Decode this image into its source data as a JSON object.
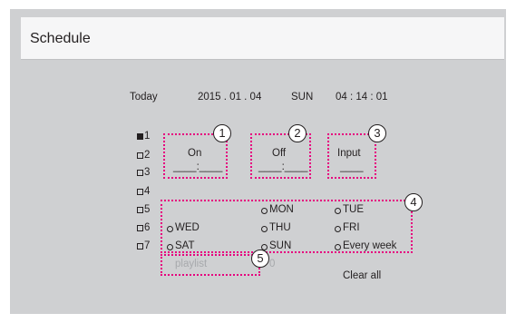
{
  "window": {
    "title": "Schedule"
  },
  "datetime": {
    "today_label": "Today",
    "date": "2015 . 01 . 04",
    "weekday": "SUN",
    "time": "04 : 14 : 01"
  },
  "schedules": [
    {
      "label": "1",
      "checked": true
    },
    {
      "label": "2",
      "checked": false
    },
    {
      "label": "3",
      "checked": false
    },
    {
      "label": "4",
      "checked": false
    },
    {
      "label": "5",
      "checked": false
    },
    {
      "label": "6",
      "checked": false
    },
    {
      "label": "7",
      "checked": false
    }
  ],
  "on_time": {
    "label": "On",
    "value": "____:____"
  },
  "off_time": {
    "label": "Off",
    "value": "____:____"
  },
  "input": {
    "label": "Input",
    "value": "____"
  },
  "days": [
    "MON",
    "TUE",
    "WED",
    "THU",
    "FRI",
    "SAT",
    "SUN",
    "Every week"
  ],
  "playlist": {
    "label": "playlist",
    "value": "0"
  },
  "clear_all": "Clear all",
  "callouts": [
    "1",
    "2",
    "3",
    "4",
    "5"
  ],
  "colors": {
    "highlight": "#e6007e",
    "panel": "#cfd0d2",
    "titlebar": "#f6f6f7"
  }
}
